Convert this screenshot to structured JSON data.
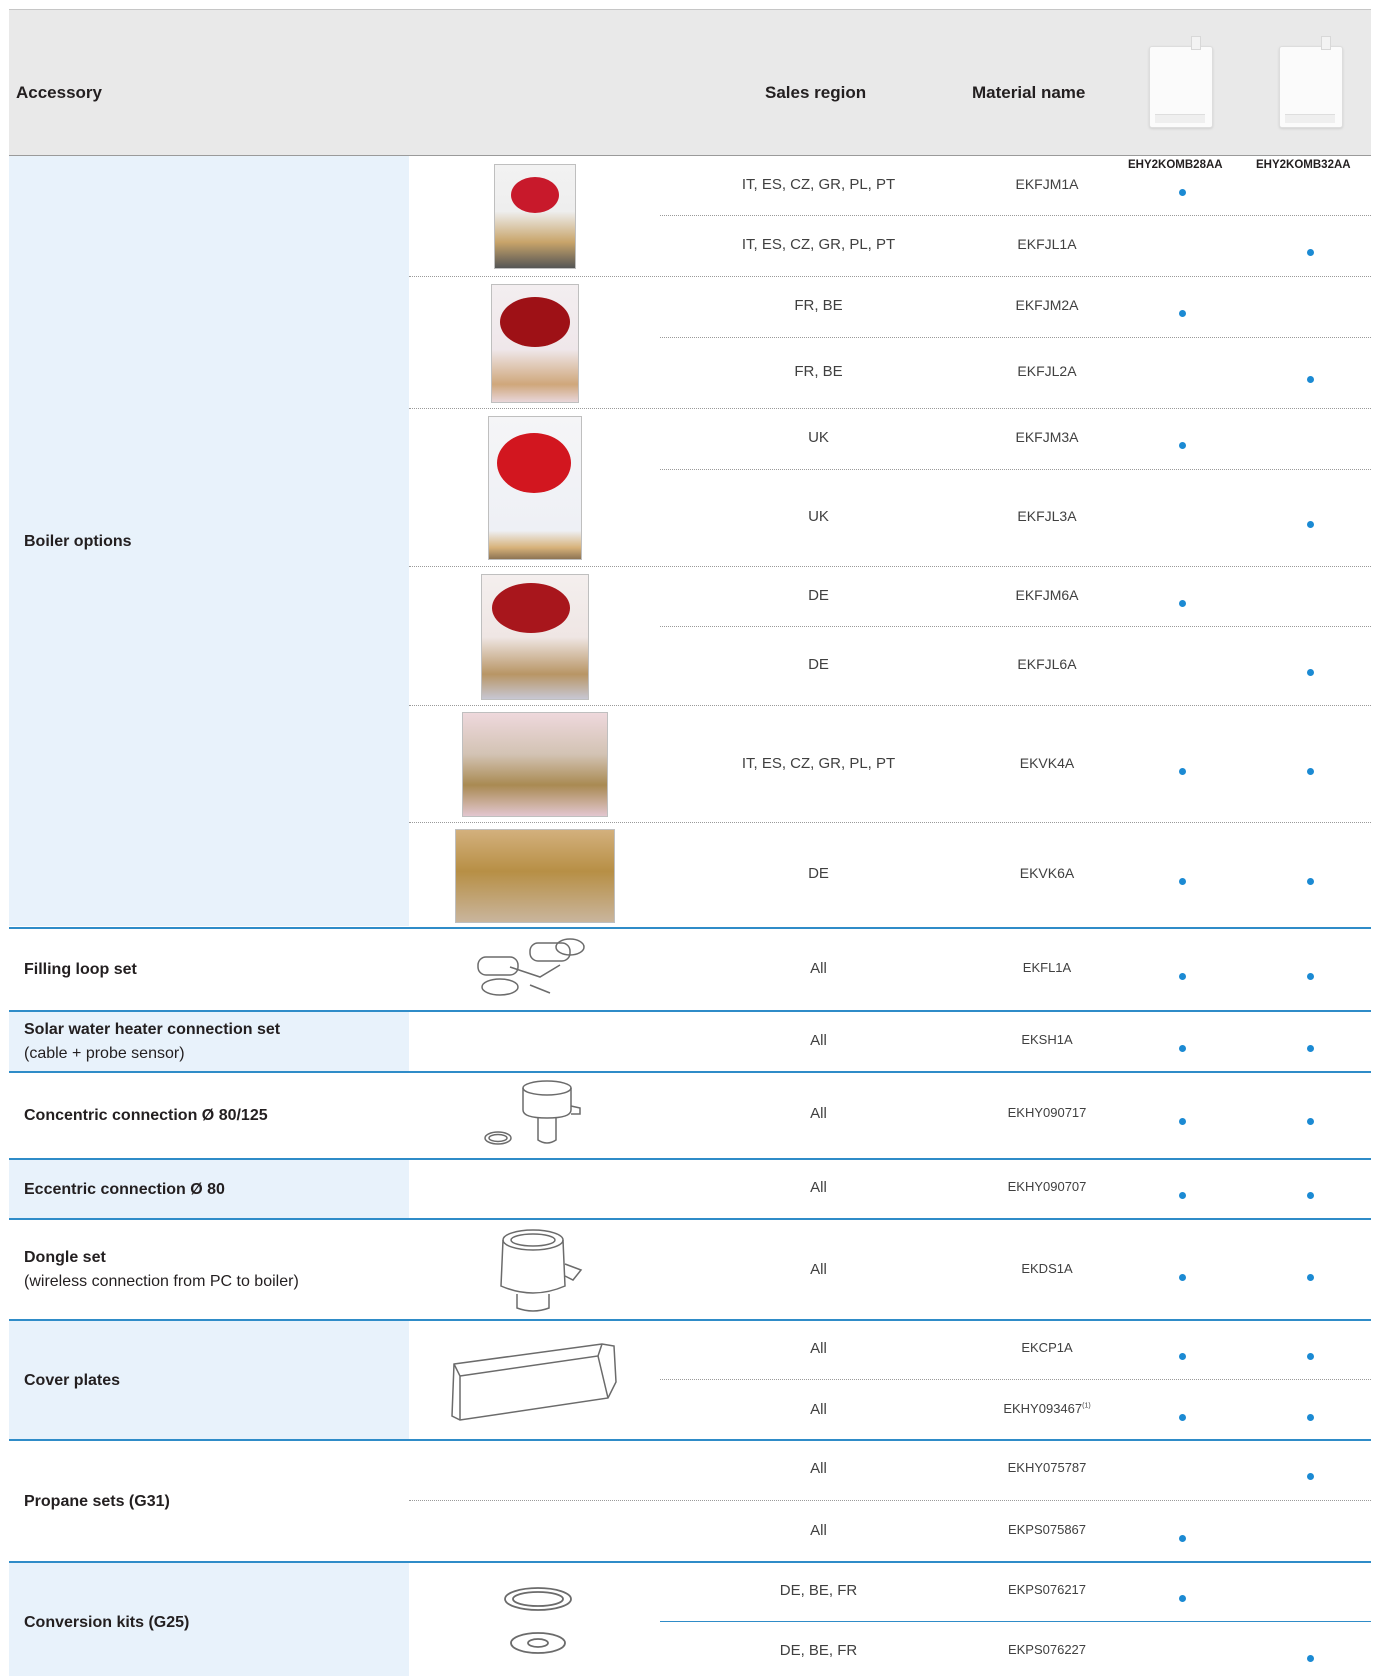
{
  "header": {
    "accessory": "Accessory",
    "sales_region": "Sales region",
    "material_name": "Material name",
    "model_1": "EHY2KOMB28AA",
    "model_2": "EHY2KOMB32AA"
  },
  "groups": [
    {
      "label": "Boiler options",
      "sublabel": ""
    },
    {
      "label": "Filling loop set",
      "sublabel": ""
    },
    {
      "label": "Solar water heater connection set",
      "sublabel": "(cable + probe sensor)"
    },
    {
      "label": "Concentric connection Ø 80/125",
      "sublabel": ""
    },
    {
      "label": "Eccentric connection Ø 80",
      "sublabel": ""
    },
    {
      "label": "Dongle set",
      "sublabel": "(wireless connection from PC to boiler)"
    },
    {
      "label": "Cover plates",
      "sublabel": ""
    },
    {
      "label": "Propane sets (G31)",
      "sublabel": ""
    },
    {
      "label": "Conversion kits (G25)",
      "sublabel": ""
    }
  ],
  "rows": [
    {
      "region": "IT, ES, CZ, GR, PL, PT",
      "material": "EKFJM1A",
      "m28": true,
      "m32": false
    },
    {
      "region": "IT, ES, CZ, GR, PL, PT",
      "material": "EKFJL1A",
      "m28": false,
      "m32": true
    },
    {
      "region": "FR, BE",
      "material": "EKFJM2A",
      "m28": true,
      "m32": false
    },
    {
      "region": "FR, BE",
      "material": "EKFJL2A",
      "m28": false,
      "m32": true
    },
    {
      "region": "UK",
      "material": "EKFJM3A",
      "m28": true,
      "m32": false
    },
    {
      "region": "UK",
      "material": "EKFJL3A",
      "m28": false,
      "m32": true
    },
    {
      "region": "DE",
      "material": "EKFJM6A",
      "m28": true,
      "m32": false
    },
    {
      "region": "DE",
      "material": "EKFJL6A",
      "m28": false,
      "m32": true
    },
    {
      "region": "IT, ES, CZ, GR, PL, PT",
      "material": "EKVK4A",
      "m28": true,
      "m32": true
    },
    {
      "region": "DE",
      "material": "EKVK6A",
      "m28": true,
      "m32": true
    },
    {
      "region": "All",
      "material": "EKFL1A",
      "m28": true,
      "m32": true
    },
    {
      "region": "All",
      "material": "EKSH1A",
      "m28": true,
      "m32": true
    },
    {
      "region": "All",
      "material": "EKHY090717",
      "m28": true,
      "m32": true
    },
    {
      "region": "All",
      "material": "EKHY090707",
      "m28": true,
      "m32": true
    },
    {
      "region": "All",
      "material": "EKDS1A",
      "m28": true,
      "m32": true
    },
    {
      "region": "All",
      "material": "EKCP1A",
      "m28": true,
      "m32": true
    },
    {
      "region": "All",
      "material": "EKHY093467",
      "footnote": "(1)",
      "m28": true,
      "m32": true
    },
    {
      "region": "All",
      "material": "EKHY075787",
      "m28": false,
      "m32": true
    },
    {
      "region": "All",
      "material": "EKPS075867",
      "m28": true,
      "m32": false
    },
    {
      "region": "DE, BE, FR",
      "material": "EKPS076217",
      "m28": true,
      "m32": false
    },
    {
      "region": "DE, BE, FR",
      "material": "EKPS076227",
      "m28": false,
      "m32": true
    }
  ],
  "colors": {
    "dot": "#1b8ad3",
    "rule": "#2f8cc8",
    "label_bg": "#e8f2fb",
    "header_bg": "#e9e9e9"
  }
}
